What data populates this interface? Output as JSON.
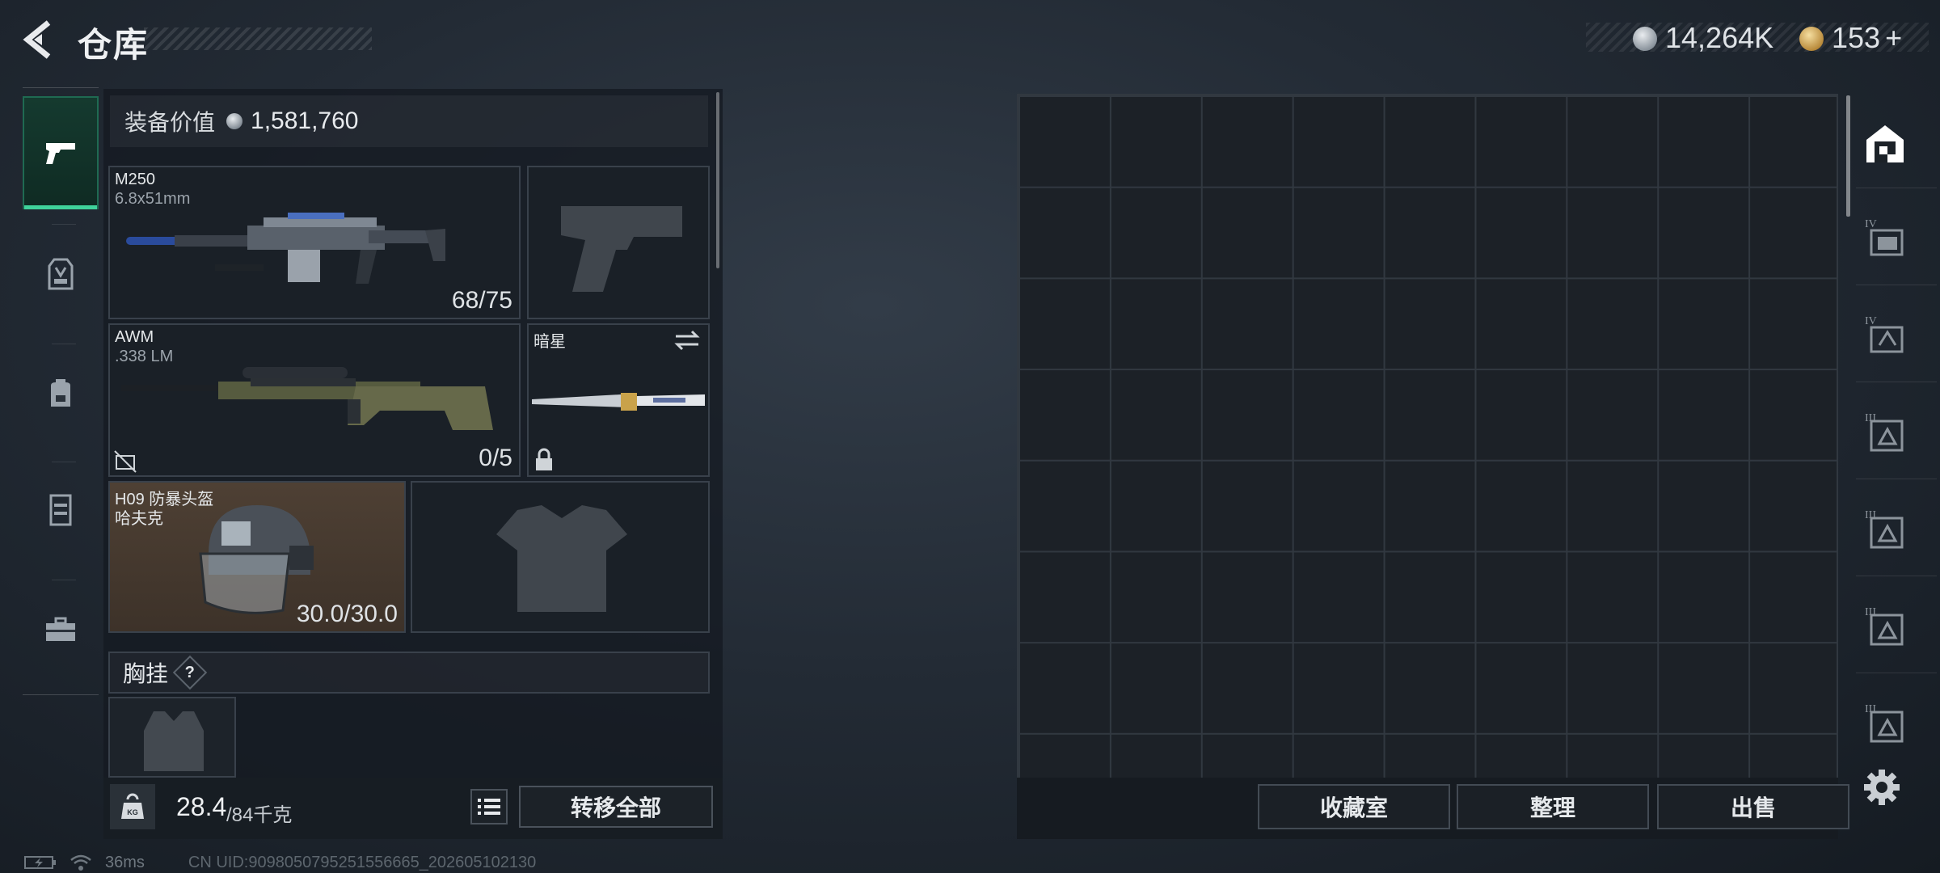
{
  "header": {
    "title": "仓库",
    "currencies": [
      {
        "icon": "silver-coin-icon",
        "amount": "14,264K"
      },
      {
        "icon": "gold-coin-icon",
        "amount": "153"
      }
    ],
    "add_symbol": "+"
  },
  "left_nav": {
    "items": [
      {
        "name": "weapons",
        "icon": "pistol-icon",
        "active": true
      },
      {
        "name": "gear",
        "icon": "vest-icon",
        "active": false
      },
      {
        "name": "backpack",
        "icon": "backpack-icon",
        "active": false
      },
      {
        "name": "container",
        "icon": "case-icon",
        "active": false
      },
      {
        "name": "toolbox",
        "icon": "toolbox-icon",
        "active": false
      }
    ]
  },
  "equipment": {
    "value_label": "装备价值",
    "value_amount": "1,581,760",
    "primary": {
      "name": "M250",
      "caliber": "6.8x51mm",
      "ammo": "68/75"
    },
    "secondary": {
      "name": "AWM",
      "caliber": ".338 LM",
      "ammo": "0/5"
    },
    "knife": {
      "name": "暗星"
    },
    "helmet": {
      "name": "H09 防暴头盔",
      "brand": "哈夫克",
      "durability": "30.0/30.0"
    },
    "chest_rig": {
      "label": "胸挂",
      "help": "?"
    }
  },
  "weight": {
    "current": "28.4",
    "max": "/84千克",
    "icon_label": "KG"
  },
  "actions": {
    "transfer_all": "转移全部",
    "collection_room": "收藏室",
    "organize": "整理",
    "sell": "出售"
  },
  "right_tabs": [
    {
      "icon": "home-storage-icon",
      "active": true
    },
    {
      "icon": "storage-box-iv-icon",
      "tier": "IV"
    },
    {
      "icon": "storage-box-iv-icon",
      "tier": "IV"
    },
    {
      "icon": "storage-box-iii-icon",
      "tier": "III"
    },
    {
      "icon": "storage-box-iii-icon",
      "tier": "III"
    },
    {
      "icon": "storage-box-iii-icon",
      "tier": "III"
    },
    {
      "icon": "storage-box-iii-icon",
      "tier": "III"
    }
  ],
  "status_bar": {
    "ping": "36ms",
    "uid": "CN UID:9098050795251556665_202605102130"
  },
  "colors": {
    "accent_green": "#3fd39b",
    "helmet_slot_bg": "#4e4034"
  }
}
